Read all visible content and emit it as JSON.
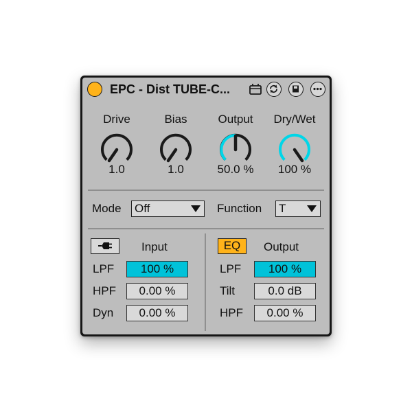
{
  "device": {
    "title": "EPC - Dist TUBE-C...",
    "accent_color": "#00d6e8",
    "power_color": "#ffb31a",
    "title_icons": [
      "tape-icon",
      "hot-swap-icon",
      "save-icon",
      "more-options-icon"
    ]
  },
  "knobs": [
    {
      "label": "Drive",
      "value": "1.0"
    },
    {
      "label": "Bias",
      "value": "1.0"
    },
    {
      "label": "Output",
      "value": "50.0 %"
    },
    {
      "label": "Dry/Wet",
      "value": "100 %"
    }
  ],
  "mode": {
    "label": "Mode",
    "selected": "Off"
  },
  "function": {
    "label": "Function",
    "selected": "T"
  },
  "input": {
    "plug_icon": "plug-icon",
    "title": "Input",
    "rows": [
      {
        "label": "LPF",
        "value": "100 %"
      },
      {
        "label": "HPF",
        "value": "0.00 %"
      },
      {
        "label": "Dyn",
        "value": "0.00 %"
      }
    ]
  },
  "output": {
    "eq_label": "EQ",
    "title": "Output",
    "rows": [
      {
        "label": "LPF",
        "value": "100 %"
      },
      {
        "label": "Tilt",
        "value": "0.0 dB"
      },
      {
        "label": "HPF",
        "value": "0.00 %"
      }
    ]
  }
}
